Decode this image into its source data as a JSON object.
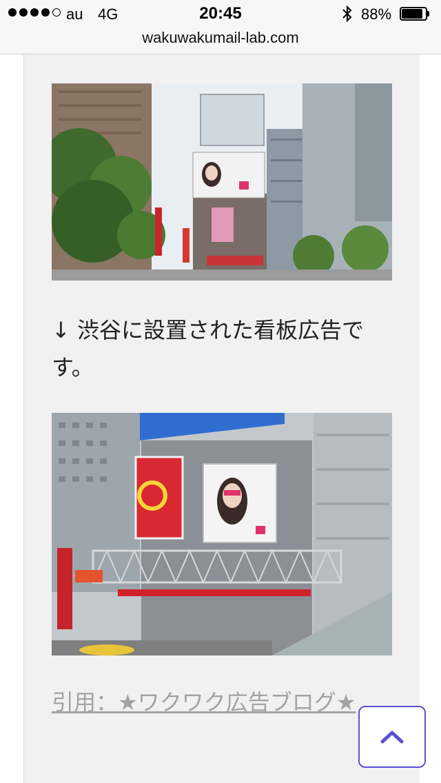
{
  "status_bar": {
    "carrier": "au",
    "network": "4G",
    "time": "20:45",
    "battery_percent": "88%"
  },
  "url_bar": {
    "domain": "wakuwakumail-lab.com"
  },
  "article": {
    "caption": "↓ 渋谷に設置された看板広告です。",
    "citation": "引用：★ワクワク広告ブログ★"
  },
  "colors": {
    "accent": "#5b4fd6",
    "card_background": "#f1f1f1",
    "citation_text": "#a3a3a3"
  },
  "icons": {
    "scroll_top": "chevron-up-icon",
    "bluetooth": "bluetooth-icon",
    "battery": "battery-icon"
  }
}
